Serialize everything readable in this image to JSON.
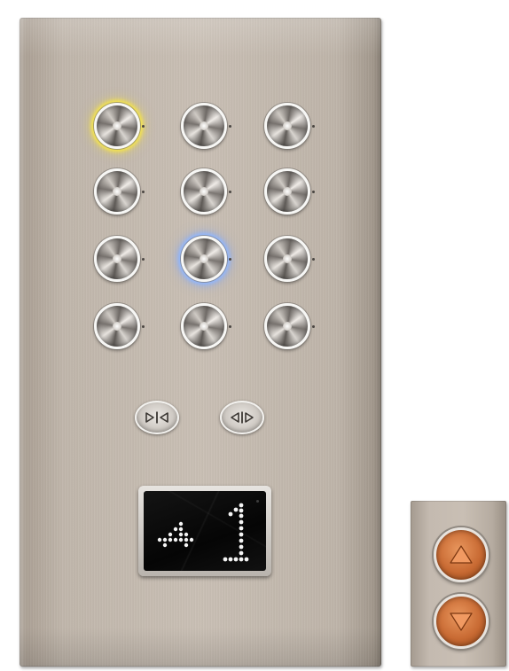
{
  "elevator_panel": {
    "floor_buttons": [
      {
        "state": "lit",
        "glow_color": "#f6e64a"
      },
      {
        "state": "off"
      },
      {
        "state": "off"
      },
      {
        "state": "off"
      },
      {
        "state": "off"
      },
      {
        "state": "off"
      },
      {
        "state": "off"
      },
      {
        "state": "lit",
        "glow_color": "#8fb7ff"
      },
      {
        "state": "off"
      },
      {
        "state": "off"
      },
      {
        "state": "off"
      },
      {
        "state": "off"
      }
    ],
    "door_buttons": [
      {
        "icon": "door-close-icon"
      },
      {
        "icon": "door-open-icon"
      }
    ],
    "display": {
      "direction_icon": "direction-arrow-dot-matrix-icon",
      "floor": "1",
      "led_color": "#ffffff"
    }
  },
  "call_panel": {
    "buttons": [
      {
        "icon": "arrow-up-icon",
        "color": "#c86a33"
      },
      {
        "icon": "arrow-down-icon",
        "color": "#c86a33"
      }
    ]
  }
}
